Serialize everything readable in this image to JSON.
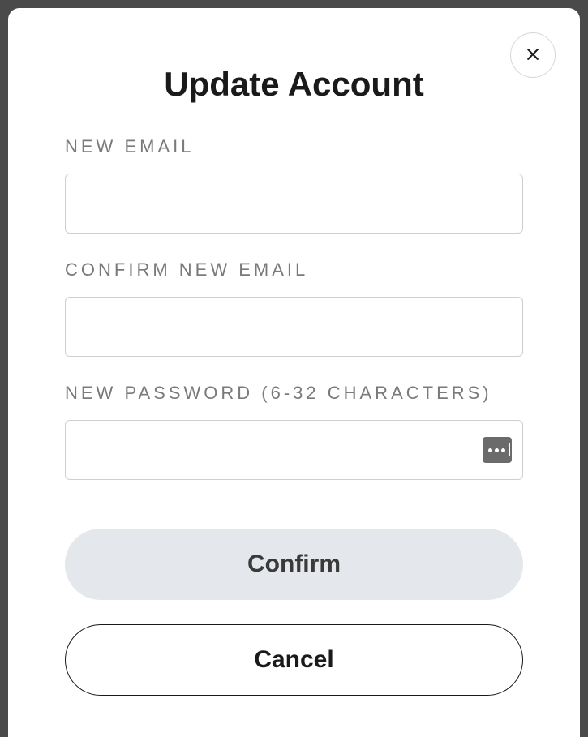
{
  "modal": {
    "title": "Update Account",
    "fields": {
      "new_email": {
        "label": "NEW EMAIL",
        "value": ""
      },
      "confirm_email": {
        "label": "CONFIRM NEW EMAIL",
        "value": ""
      },
      "new_password": {
        "label": "NEW PASSWORD (6-32 CHARACTERS)",
        "value": ""
      }
    },
    "buttons": {
      "confirm": "Confirm",
      "cancel": "Cancel"
    }
  }
}
